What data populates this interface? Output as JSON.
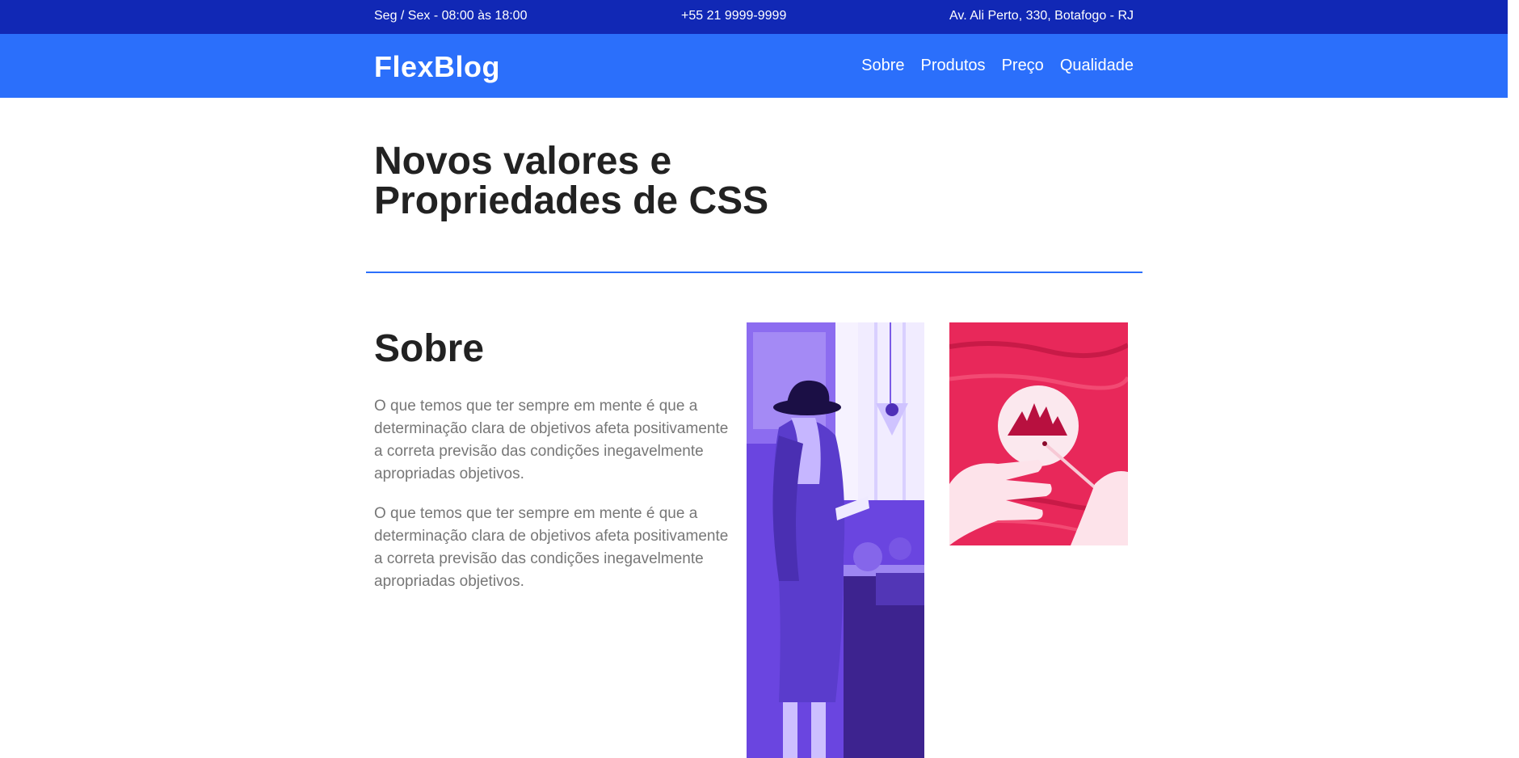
{
  "topbar": {
    "hours": "Seg / Sex - 08:00 às 18:00",
    "phone": "+55 21 9999-9999",
    "address": "Av. Ali Perto, 330, Botafogo - RJ"
  },
  "header": {
    "logo": "FlexBlog",
    "nav": [
      "Sobre",
      "Produtos",
      "Preço",
      "Qualidade"
    ]
  },
  "hero": {
    "title_line1": "Novos valores e",
    "title_line2": "Propriedades de CSS"
  },
  "sobre": {
    "title": "Sobre",
    "paragraphs": [
      "O que temos que ter sempre em mente é que a determinação clara de objetivos afeta positivamente a correta previsão das condições inegavelmente apropriadas objetivos.",
      "O que temos que ter sempre em mente é que a determinação clara de objetivos afeta positivamente a correta previsão das condições inegavelmente apropriadas objetivos."
    ]
  },
  "colors": {
    "topbar_bg": "#1128b5",
    "header_bg": "#2b6ffb",
    "accent": "#2b6ffb",
    "photo_purple": "#6a45e0",
    "photo_pink": "#ee2f5d"
  }
}
